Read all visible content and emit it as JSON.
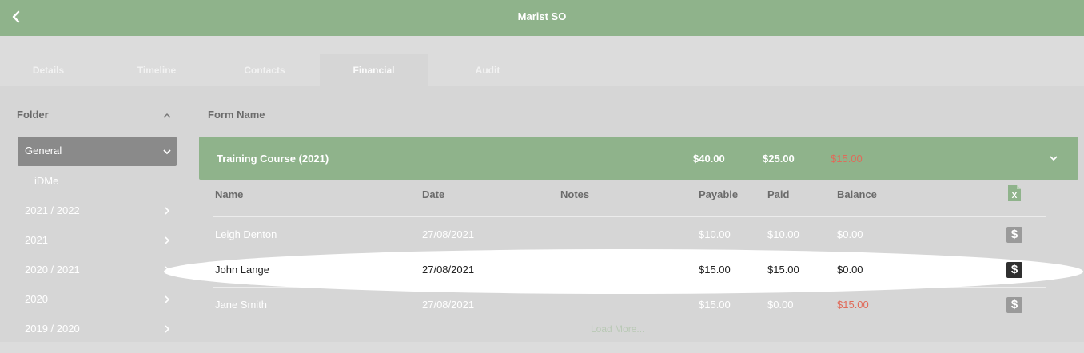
{
  "header": {
    "title": "Marist SO",
    "back_icon": "chevron-left-icon"
  },
  "tabs": [
    {
      "label": "Details",
      "active": false
    },
    {
      "label": "Timeline",
      "active": false
    },
    {
      "label": "Contacts",
      "active": false
    },
    {
      "label": "Financial",
      "active": true
    },
    {
      "label": "Audit",
      "active": false
    }
  ],
  "sidebar": {
    "title": "Folder",
    "selected": {
      "label": "General"
    },
    "sub_item": "iDMe",
    "items": [
      {
        "label": "2021 / 2022"
      },
      {
        "label": "2021"
      },
      {
        "label": "2020 / 2021"
      },
      {
        "label": "2020"
      },
      {
        "label": "2019 / 2020"
      }
    ]
  },
  "form_name_label": "Form Name",
  "course": {
    "name": "Training Course (2021)",
    "payable": "$40.00",
    "paid": "$25.00",
    "balance": "$15.00"
  },
  "table": {
    "columns": {
      "name": "Name",
      "date": "Date",
      "notes": "Notes",
      "payable": "Payable",
      "paid": "Paid",
      "balance": "Balance"
    },
    "rows": [
      {
        "name": "Leigh Denton",
        "date": "27/08/2021",
        "notes": "",
        "payable": "$10.00",
        "paid": "$10.00",
        "balance": "$0.00",
        "icon": "$"
      },
      {
        "name": "John Lange",
        "date": "27/08/2021",
        "notes": "",
        "payable": "$15.00",
        "paid": "$15.00",
        "balance": "$0.00",
        "icon": "$"
      },
      {
        "name": "Jane Smith",
        "date": "27/08/2021",
        "notes": "",
        "payable": "$15.00",
        "paid": "$0.00",
        "balance": "$15.00",
        "icon": "$"
      }
    ]
  },
  "load_more": "Load More...",
  "colors": {
    "header": "#8fb38b",
    "negative": "#e06b5a",
    "background": "#dcdcdc"
  }
}
